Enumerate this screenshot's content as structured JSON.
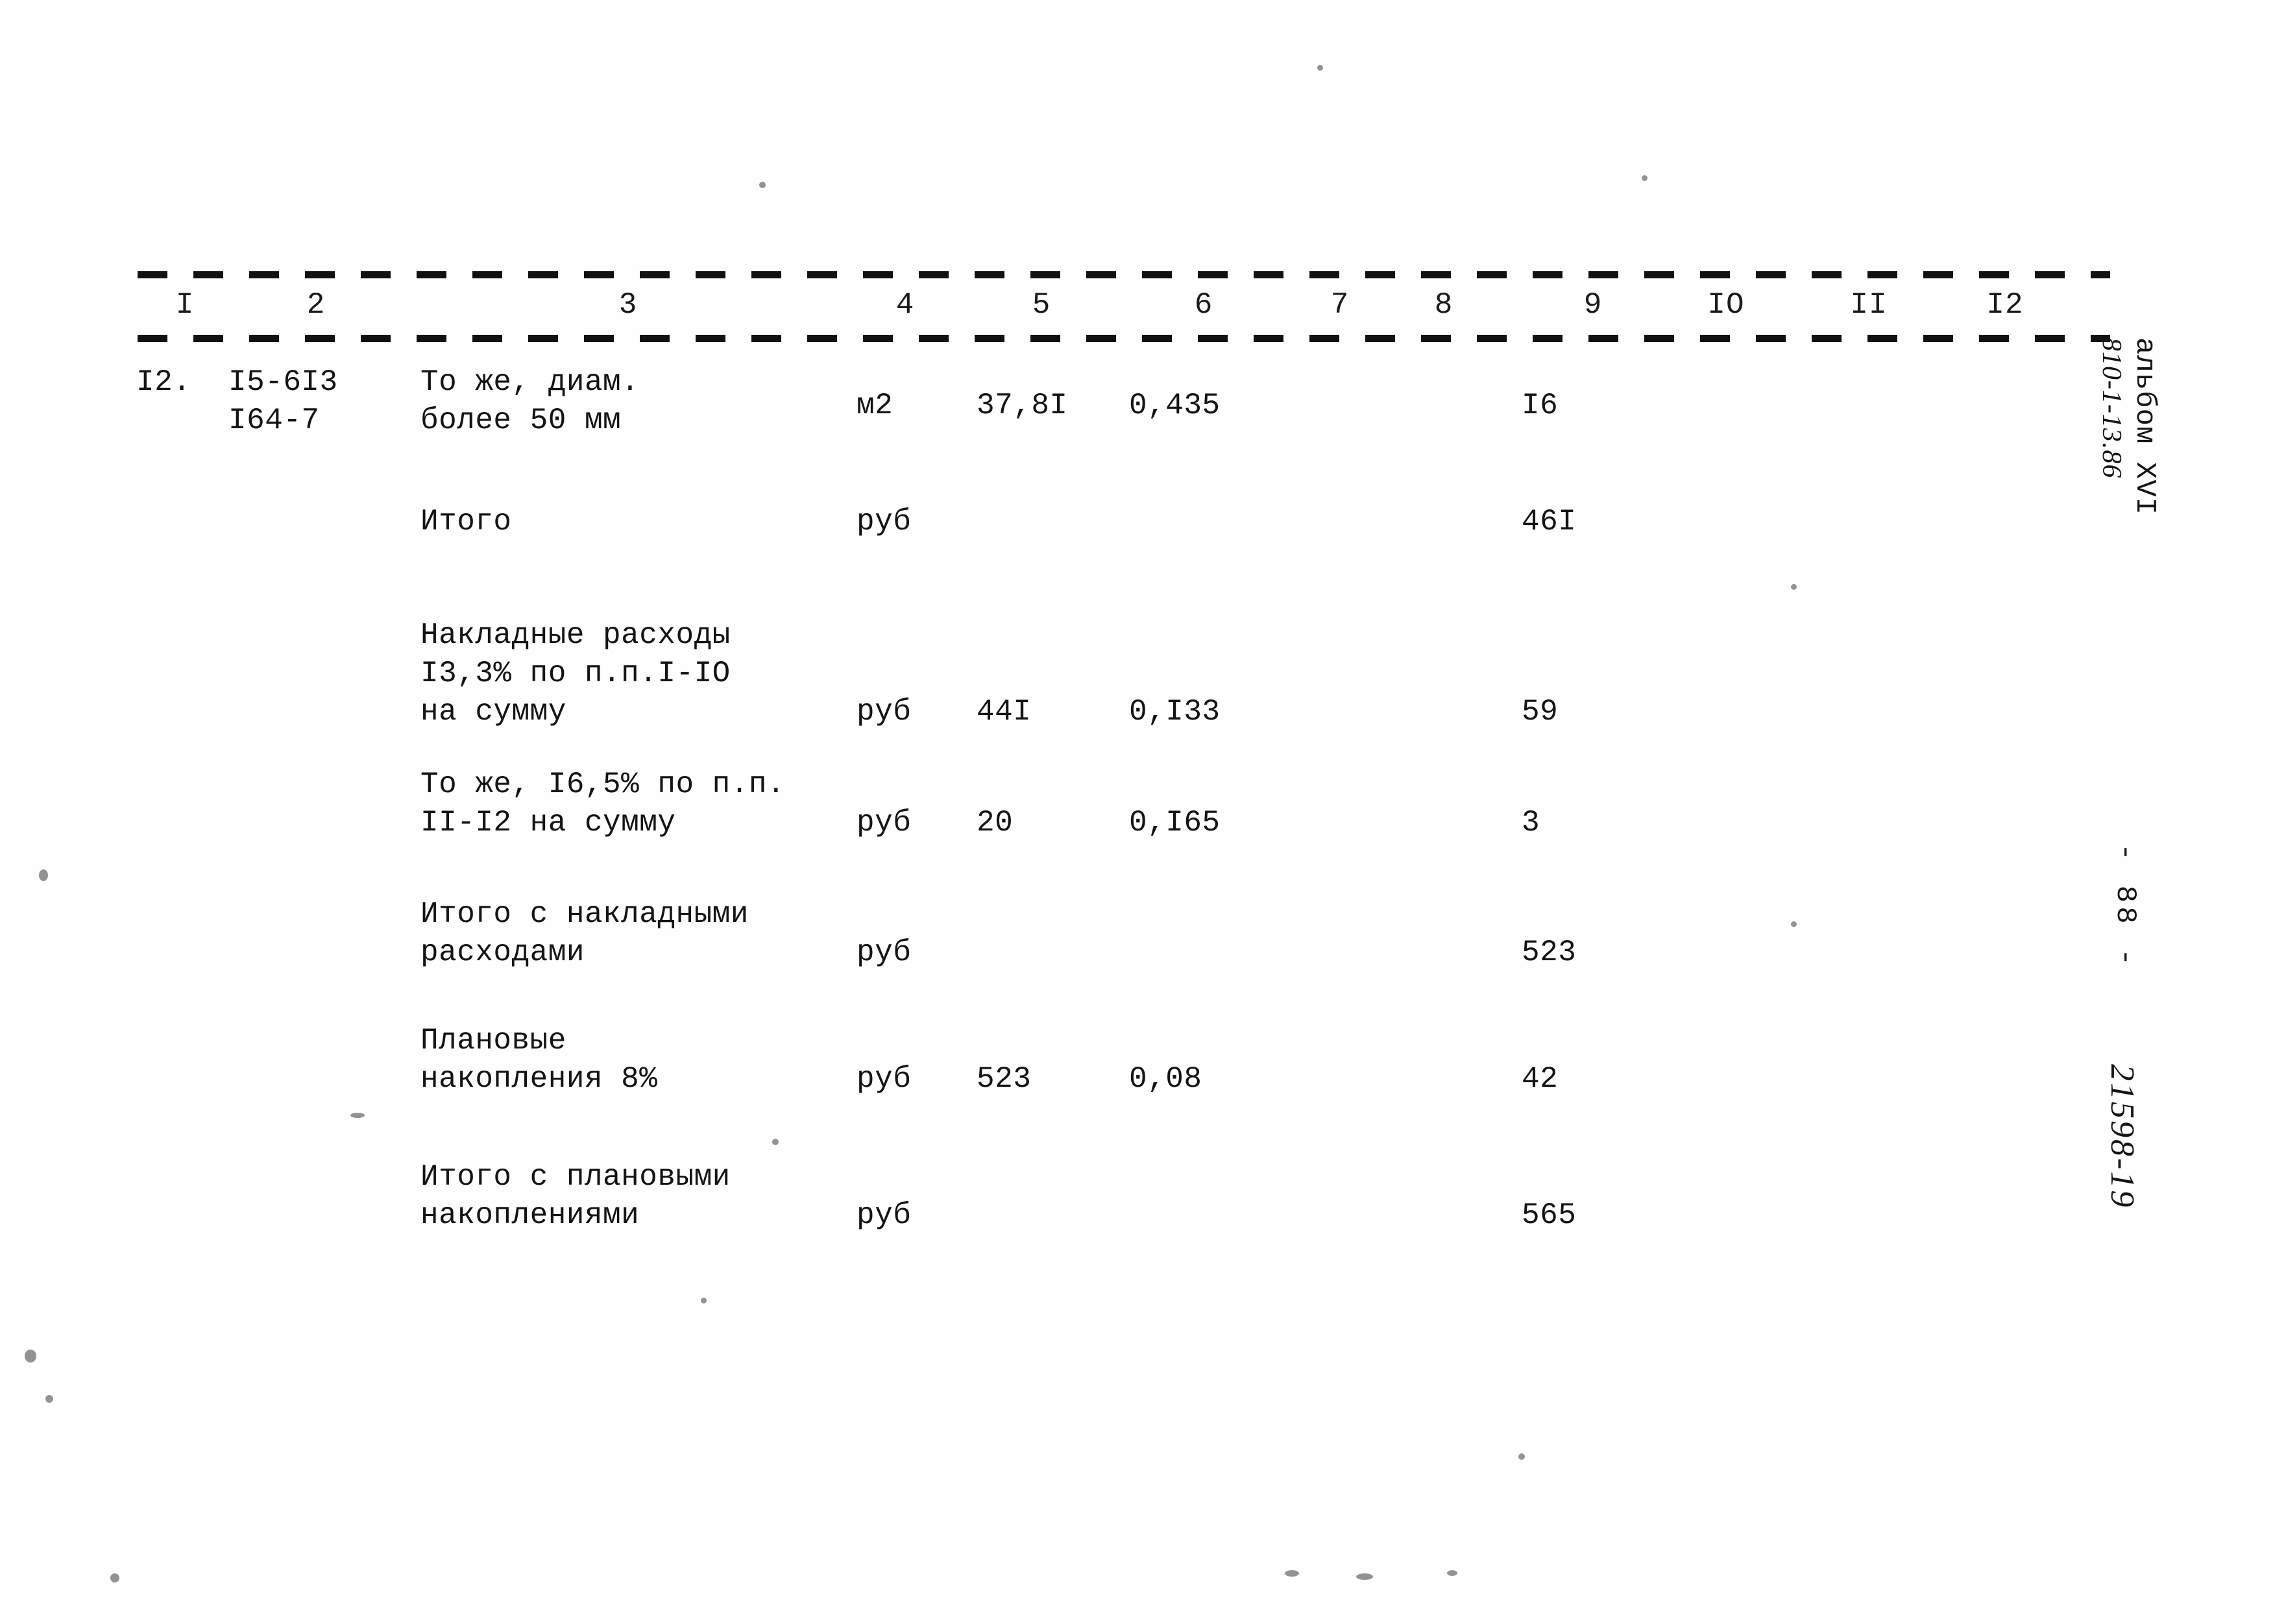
{
  "document": {
    "album_label": "альбом XVI",
    "album_code": "810-1-13.86",
    "page_number": "- 88 -",
    "doc_code": "21598-19"
  },
  "table": {
    "column_headers": [
      "I",
      "2",
      "3",
      "4",
      "5",
      "6",
      "7",
      "8",
      "9",
      "IO",
      "II",
      "I2"
    ],
    "rows": [
      {
        "c1": "I2.",
        "c2": "I5-6I3\nI64-7",
        "c3": "То же, диам.\nболее 50 мм",
        "c4": "м2",
        "c5": "37,8I",
        "c6": "0,435",
        "c7": "",
        "c8": "",
        "c9": "I6",
        "c10": "",
        "c11": "",
        "c12": ""
      },
      {
        "c1": "",
        "c2": "",
        "c3": "Итого",
        "c4": "руб",
        "c5": "",
        "c6": "",
        "c7": "",
        "c8": "",
        "c9": "46I",
        "c10": "",
        "c11": "",
        "c12": ""
      },
      {
        "c1": "",
        "c2": "",
        "c3": "Накладные расходы\nI3,3% по п.п.I-IO\nна сумму",
        "c4": "руб",
        "c5": "44I",
        "c6": "0,I33",
        "c7": "",
        "c8": "",
        "c9": "59",
        "c10": "",
        "c11": "",
        "c12": ""
      },
      {
        "c1": "",
        "c2": "",
        "c3": "То же, I6,5% по п.п.\nII-I2 на сумму",
        "c4": "руб",
        "c5": "20",
        "c6": "0,I65",
        "c7": "",
        "c8": "",
        "c9": "3",
        "c10": "",
        "c11": "",
        "c12": ""
      },
      {
        "c1": "",
        "c2": "",
        "c3": "Итого с накладными\nрасходами",
        "c4": "руб",
        "c5": "",
        "c6": "",
        "c7": "",
        "c8": "",
        "c9": "523",
        "c10": "",
        "c11": "",
        "c12": ""
      },
      {
        "c1": "",
        "c2": "",
        "c3": "Плановые\nнакопления 8%",
        "c4": "руб",
        "c5": "523",
        "c6": "0,08",
        "c7": "",
        "c8": "",
        "c9": "42",
        "c10": "",
        "c11": "",
        "c12": ""
      },
      {
        "c1": "",
        "c2": "",
        "c3": "Итого с плановыми\nнакоплениями",
        "c4": "руб",
        "c5": "",
        "c6": "",
        "c7": "",
        "c8": "",
        "c9": "565",
        "c10": "",
        "c11": "",
        "c12": ""
      }
    ]
  }
}
